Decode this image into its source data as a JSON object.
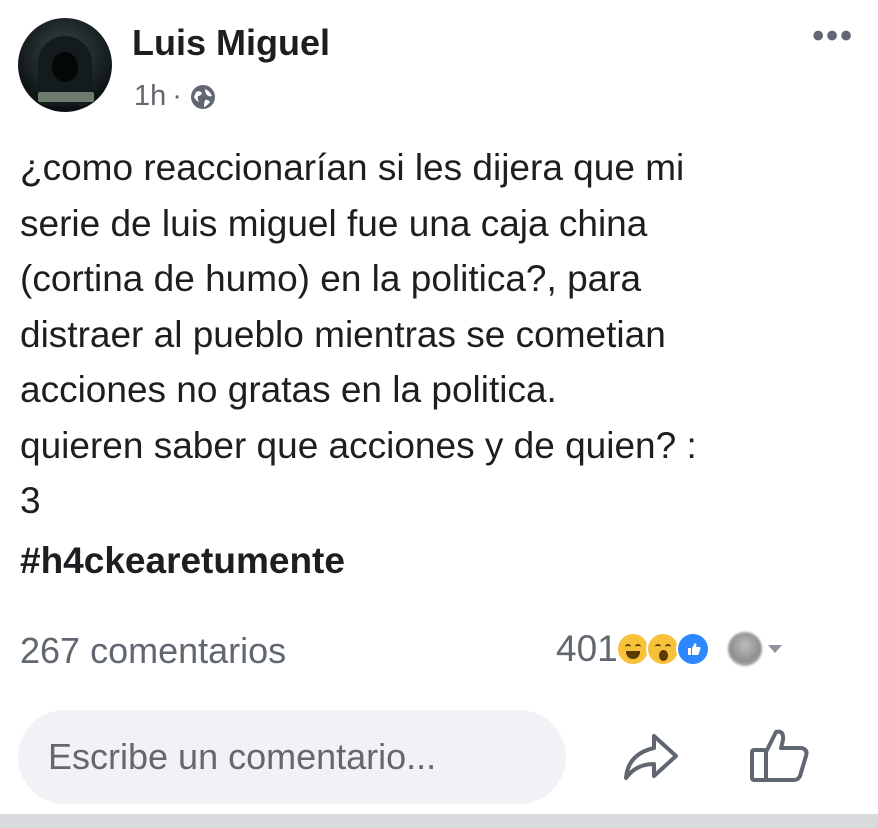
{
  "post": {
    "author": "Luis Miguel",
    "time": "1h",
    "separator": "·",
    "privacy_icon": "globe-icon",
    "more_icon": "more-options-icon",
    "text": "¿como reaccionarían si les dijera que mi\nserie de luis miguel fue una caja china\n(cortina de humo) en la politica?, para\ndistraer al pueblo mientras se cometian\nacciones no gratas en la politica.\nquieren saber que acciones y de quien? :\n3",
    "hashtag": "#h4ckearetumente",
    "comments": "267 comentarios",
    "reactions_count": "401",
    "reaction_icons": [
      "haha-icon",
      "wow-icon",
      "like-icon"
    ]
  },
  "composer": {
    "placeholder": "Escribe un comentario..."
  },
  "actions": {
    "share_icon": "share-icon",
    "like_icon": "like-icon"
  },
  "colors": {
    "text": "#1c1e21",
    "secondary": "#606770",
    "like_blue": "#2d88ff",
    "input_bg": "#f0f2f5"
  }
}
